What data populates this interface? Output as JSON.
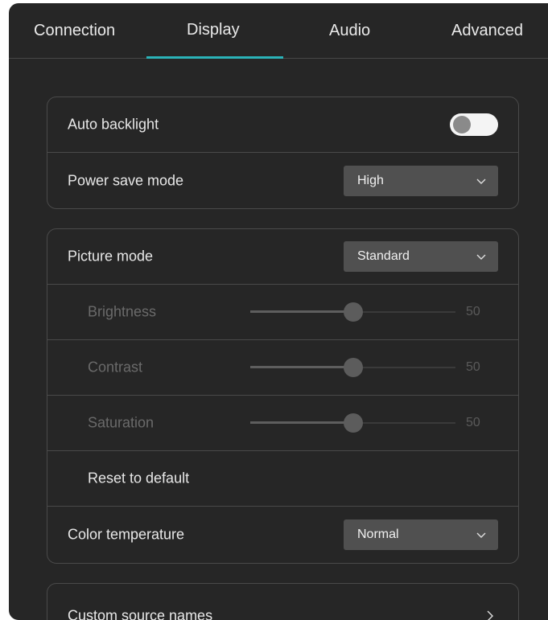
{
  "tabs": [
    {
      "label": "Connection",
      "active": false
    },
    {
      "label": "Display",
      "active": true
    },
    {
      "label": "Audio",
      "active": false
    },
    {
      "label": "Advanced",
      "active": false
    }
  ],
  "accent_color": "#2bb3b8",
  "power": {
    "auto_backlight_label": "Auto backlight",
    "auto_backlight_on": false,
    "power_save_label": "Power save mode",
    "power_save_value": "High"
  },
  "picture": {
    "picture_mode_label": "Picture mode",
    "picture_mode_value": "Standard",
    "brightness_label": "Brightness",
    "brightness_value": "50",
    "contrast_label": "Contrast",
    "contrast_value": "50",
    "saturation_label": "Saturation",
    "saturation_value": "50",
    "reset_label": "Reset to default",
    "color_temp_label": "Color temperature",
    "color_temp_value": "Normal"
  },
  "sources": {
    "custom_names_label": "Custom source names"
  },
  "icons": {
    "dropdown": "chevron-down-icon",
    "navigate": "chevron-right-icon"
  }
}
